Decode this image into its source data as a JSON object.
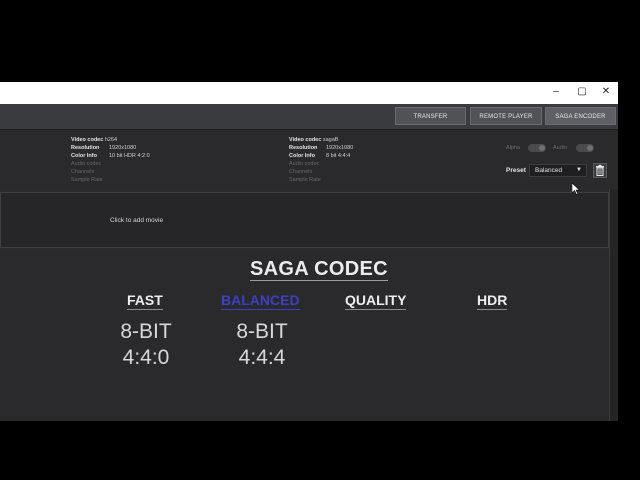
{
  "window": {
    "controls": {
      "minimize": "–",
      "maximize": "▢",
      "close": "✕"
    }
  },
  "toolbar": {
    "transfer": "TRANSFER",
    "remote_player": "REMOTE PLAYER",
    "saga_encoder": "SAGA ENCODER"
  },
  "source": {
    "video_codec_label": "Video codec",
    "video_codec": "h264",
    "resolution_label": "Resolution",
    "resolution": "1920x1080",
    "color_info_label": "Color Info",
    "color_info": "10 bit HDR 4:2:0",
    "audio_codec_label": "Audio codec",
    "channels_label": "Channels",
    "sample_rate_label": "Sample Rate"
  },
  "output": {
    "video_codec_label": "Video codec",
    "video_codec": "sagaB",
    "resolution_label": "Resolution",
    "resolution": "1920x1080",
    "color_info_label": "Color Info",
    "color_info": "8 bit 4:4:4",
    "audio_codec_label": "Audio codec",
    "channels_label": "Channels",
    "sample_rate_label": "Sample Rate"
  },
  "options": {
    "alpha_label": "Alpha",
    "audio_label": "Audio",
    "preset_label": "Preset",
    "preset_value": "Balanced"
  },
  "dropzone": {
    "text": "Click to add movie"
  },
  "saga": {
    "title": "SAGA CODEC",
    "columns": [
      {
        "label": "FAST",
        "line1": "8-BIT",
        "line2": "4:4:0"
      },
      {
        "label": "BALANCED",
        "line1": "8-BIT",
        "line2": "4:4:4"
      },
      {
        "label": "QUALITY"
      },
      {
        "label": "HDR"
      }
    ],
    "active_color": "#3d3fc3"
  }
}
